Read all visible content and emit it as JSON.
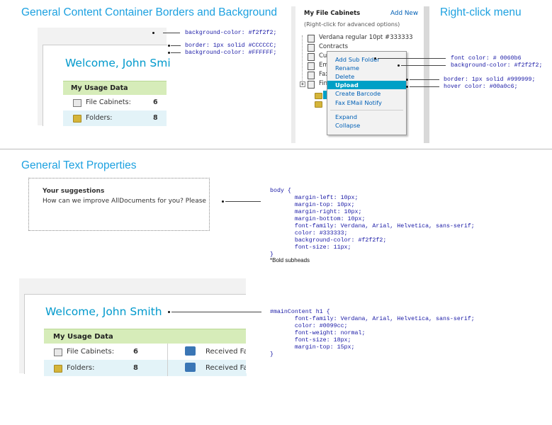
{
  "sections": {
    "containers_title": "General Content Container Borders and Background",
    "rightclick_title": "Right-click menu",
    "text_title": "General Text Properties"
  },
  "panel1": {
    "welcome": "Welcome, John Smi",
    "usage_title": "My Usage Data",
    "rows": [
      {
        "icon": "file-cabinet-icon",
        "label": "File Cabinets:",
        "value": "6"
      },
      {
        "icon": "folder-icon",
        "label": "Folders:",
        "value": "8"
      }
    ],
    "annotations": [
      "background-color: #f2f2f2;",
      "border: 1px solid #CCCCCC;",
      "background-color: #FFFFFF;"
    ]
  },
  "panel2": {
    "header_title": "My File Cabinets",
    "add_new": "Add New",
    "hint": "(Right-click for advanced options)",
    "tree": [
      "Verdana regular 10pt #333333",
      "Contracts",
      "Cu",
      "Em",
      "Fax",
      "Fin"
    ],
    "menu": [
      "Add Sub Folder",
      "Rename",
      "Delete",
      "Upload",
      "Create Barcode",
      "Fax EMail Notify",
      "Expand",
      "Collapse"
    ],
    "annotations": [
      "font color: # 0060b6",
      "background-color: #f2f2f2;",
      "border: 1px solid #999999;",
      "hover color: #00a0c6;"
    ],
    "colors": {
      "menu_text": "#0060b6",
      "menu_bg": "#f2f2f2",
      "menu_border": "#999999",
      "hover": "#00a0c6"
    }
  },
  "panel3": {
    "heading": "Your suggestions",
    "text": "How can we improve AllDocuments for you? Please",
    "code": "body {\n       margin-left: 10px;\n       margin-top: 10px;\n       margin-right: 10px;\n       margin-bottom: 10px;\n       font-family: Verdana, Arial, Helvetica, sans-serif;\n       color: #333333;\n       background-color: #f2f2f2;\n       font-size: 11px;\n}",
    "note": "*Bold subheads"
  },
  "panel4": {
    "welcome": "Welcome, John Smith",
    "usage_title": "My Usage Data",
    "rows": [
      {
        "icon": "file-cabinet-icon",
        "label": "File Cabinets:",
        "value": "6",
        "fax_icon": "received-fax-icon",
        "fax_label": "Received Fax"
      },
      {
        "icon": "folder-icon",
        "label": "Folders:",
        "value": "8",
        "fax_icon": "received-fax-icon",
        "fax_label": "Received Fax"
      }
    ],
    "code": "#mainContent h1 {\n       font-family: Verdana, Arial, Helvetica, sans-serif;\n       color: #0099cc;\n       font-weight: normal;\n       font-size: 18px;\n       margin-top: 15px;\n}"
  }
}
